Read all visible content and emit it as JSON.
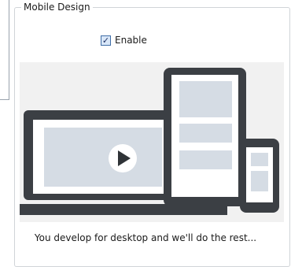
{
  "group": {
    "title": "Mobile Design",
    "enable_label": "Enable",
    "enable_checked": true,
    "caption": "You develop for desktop and we'll do the rest..."
  },
  "illustration": {
    "icon": "play-icon",
    "colors": {
      "background": "#f1f1f1",
      "device": "#3b3f44",
      "screen": "#ffffff",
      "placeholder": "#d5dce4"
    }
  }
}
